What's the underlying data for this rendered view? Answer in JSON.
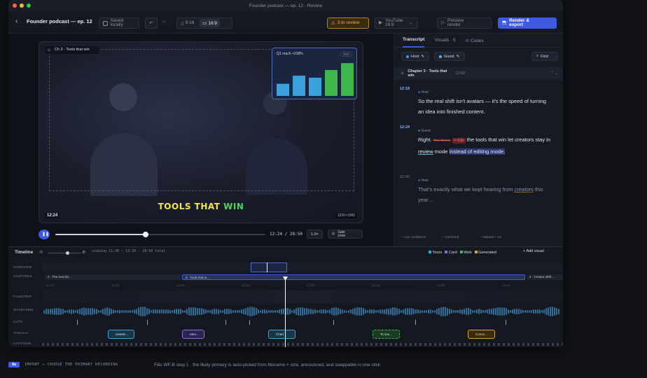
{
  "window": {
    "title": "Founder podcast — ep. 12 · Review"
  },
  "toolbar": {
    "project_title": "Founder podcast — ep. 12",
    "save_status": "Saved locally",
    "aspect_9_16": "9:16",
    "aspect_16_9": "16:9",
    "review_warning": "3 to review",
    "export_target": "YouTube · 16:9",
    "preview_render": "Preview render",
    "render_export": "Render & export"
  },
  "preview": {
    "chapter_tag": "Ch 3 · Tools that win",
    "chart_card": {
      "title": "Q1 reach +218%",
      "badge": "Web"
    },
    "overlay_main": "TOOLS THAT ",
    "overlay_accent": "WIN",
    "timecode": "12:24",
    "resolution": "1920×1080",
    "transport_time": "12:24 / 28:50",
    "speed": "1.0×",
    "safe_zone": "Safe zone",
    "progress": 0.43
  },
  "chart_data": {
    "type": "bar",
    "categories": [
      "",
      "",
      "",
      "",
      ""
    ],
    "series": [
      {
        "values": [
          3,
          5,
          4.5,
          6.4,
          8.1
        ],
        "colors": [
          "#3aa2dd",
          "#3aa2dd",
          "#3aa2dd",
          "#3cb84a",
          "#3cb84a"
        ]
      }
    ],
    "title": "Q1 reach +218%",
    "ylim": [
      0,
      9
    ]
  },
  "transcript": {
    "tabs": [
      "Transcript",
      "Visuals · 5",
      "Codex"
    ],
    "speakers": [
      "Host",
      "Guest"
    ],
    "find_label": "Find",
    "chapter": {
      "title": "Chapter 3 · Tools that win",
      "time": "12:02"
    },
    "segments": [
      {
        "time": "12:18",
        "speaker": "Host",
        "text": "So the real shift isn't avatars — it's the speed of turning an idea into finished content."
      },
      {
        "time": "12:24",
        "speaker": "Guest",
        "lead": "Right.",
        "struck": "You know,",
        "cut": "✂ 0.6s",
        "t1": "the tools that win let creators stay in",
        "t2": "review",
        "t3": "mode",
        "t4": "instead of editing mode."
      },
      {
        "time": "12:40",
        "speaker": "Host",
        "t1": "That's exactly what we kept hearing from",
        "t2": "creators",
        "t3": "this year…"
      }
    ],
    "legend": {
      "low": "Low confidence",
      "corrected": "Corrected",
      "deleted": "Deleted + cut"
    }
  },
  "timeline": {
    "title": "Timeline",
    "viewing": "viewing 11:30 – 13:30 · 28:50 total",
    "legend": {
      "yours": "Yours",
      "card": "Card",
      "web": "Web",
      "generated": "Generated",
      "add_visual": "Add visual"
    },
    "tracks": [
      "OVERVIEW",
      "CHAPTERS",
      "FILMSTRIP",
      "WAVEFORM",
      "CUTS",
      "VISUALS",
      "CAPTIONS"
    ],
    "chapters": [
      "2 · The real shi…",
      "3 · Tools that w…",
      "4 · Creator shift…"
    ],
    "ruler": [
      "11:30",
      "11:45",
      "12:00",
      "12:15",
      "12:30",
      "12:45",
      "13:00",
      "13:15"
    ],
    "visuals": [
      "newsle…",
      "Idea…",
      "Chart…",
      "To sou…",
      "Conce…"
    ]
  },
  "footer": {
    "badge": "8a",
    "step": "IMPORT → CHOOSE THE PRIMARY RECORDING",
    "note": "Fills WF-B step 1 · the likely primary is auto-picked from filename + size, announced, and swappable in one click"
  }
}
